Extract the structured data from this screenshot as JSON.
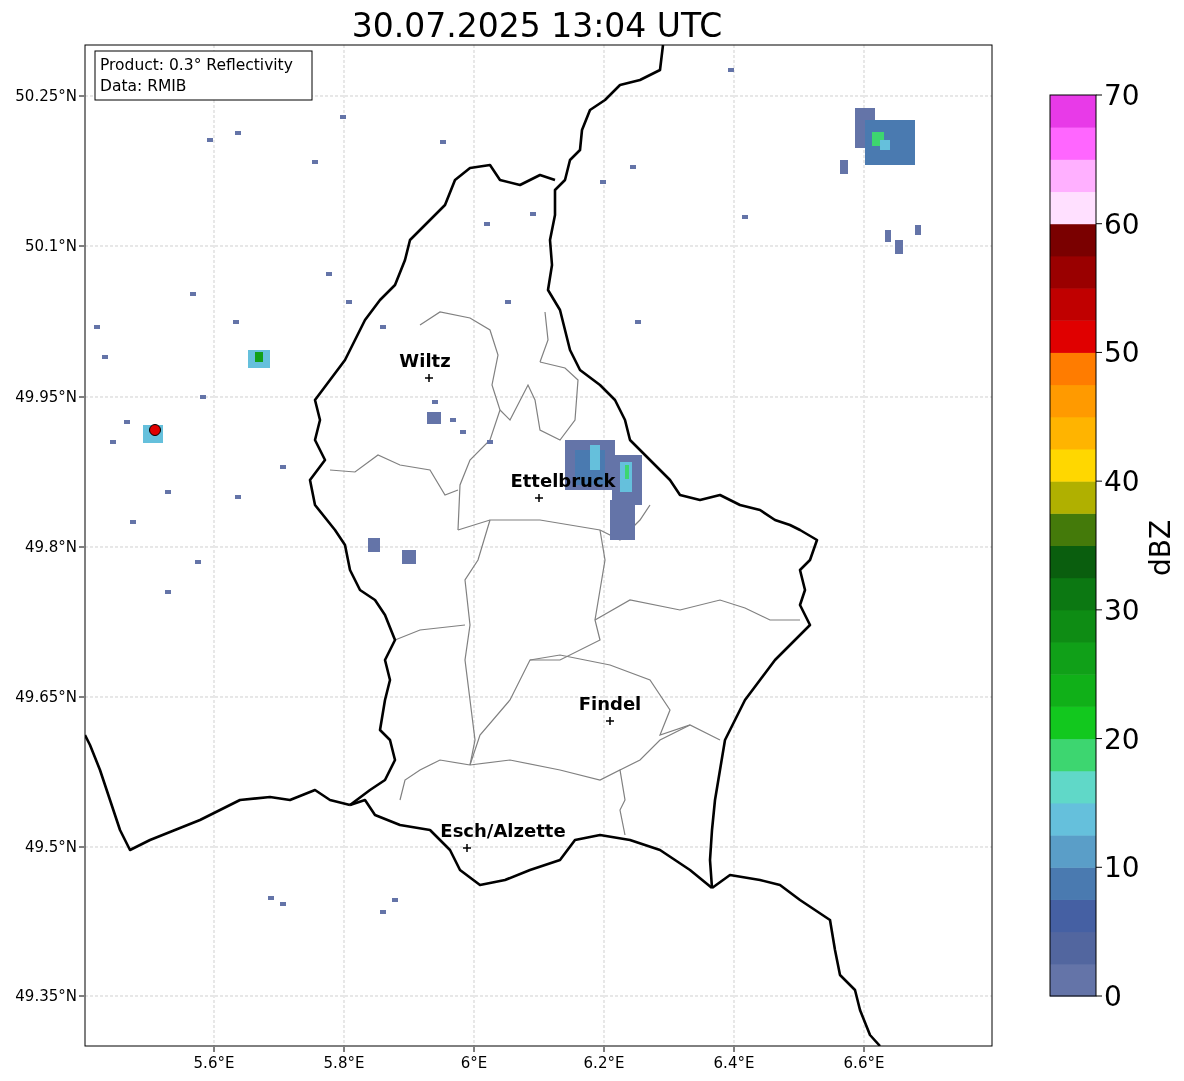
{
  "title": "30.07.2025 13:04 UTC",
  "info_box": {
    "lines": [
      "Product: 0.3° Reflectivity",
      "Data: RMIB"
    ]
  },
  "map": {
    "yticks": [
      "50.25°N",
      "50.1°N",
      "49.95°N",
      "49.8°N",
      "49.65°N",
      "49.5°N",
      "49.35°N"
    ],
    "xticks": [
      "5.6°E",
      "5.8°E",
      "6°E",
      "6.2°E",
      "6.4°E",
      "6.6°E"
    ],
    "places": [
      {
        "name": "Wiltz"
      },
      {
        "name": "Ettelbruck"
      },
      {
        "name": "Findel"
      },
      {
        "name": "Esch/Alzette"
      }
    ]
  },
  "colorbar": {
    "label": "dBZ",
    "ticks": [
      "70",
      "60",
      "50",
      "40",
      "30",
      "20",
      "10",
      "0"
    ],
    "segments": [
      {
        "color": "#6474a8"
      },
      {
        "color": "#52669f"
      },
      {
        "color": "#4560a3"
      },
      {
        "color": "#4a7ab0"
      },
      {
        "color": "#5a9ec8"
      },
      {
        "color": "#65c0dc"
      },
      {
        "color": "#60d8c8"
      },
      {
        "color": "#3dd670"
      },
      {
        "color": "#12c81e"
      },
      {
        "color": "#10b018"
      },
      {
        "color": "#10a018"
      },
      {
        "color": "#0e8c14"
      },
      {
        "color": "#0c7812"
      },
      {
        "color": "#0a5e0e"
      },
      {
        "color": "#447a0a"
      },
      {
        "color": "#b0b000"
      },
      {
        "color": "#ffd700"
      },
      {
        "color": "#ffb400"
      },
      {
        "color": "#ff9a00"
      },
      {
        "color": "#ff7c00"
      },
      {
        "color": "#e00000"
      },
      {
        "color": "#c00000"
      },
      {
        "color": "#9a0000"
      },
      {
        "color": "#7a0000"
      },
      {
        "color": "#ffe0ff"
      },
      {
        "color": "#ffb0ff"
      },
      {
        "color": "#ff66ff"
      },
      {
        "color": "#e83ae8"
      }
    ]
  }
}
